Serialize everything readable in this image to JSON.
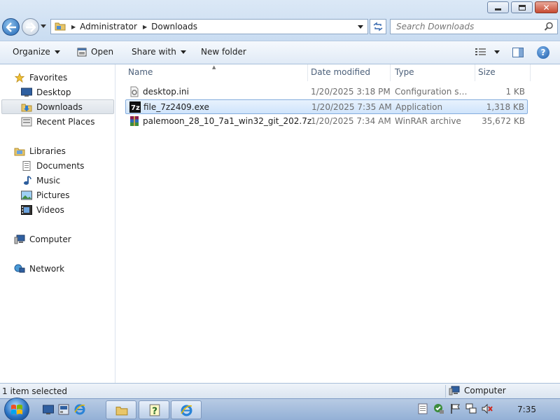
{
  "window": {
    "title_buttons": {
      "minimize": "minimize-icon",
      "maximize": "maximize-icon",
      "close": "close-icon"
    }
  },
  "address": {
    "crumbs": [
      "Administrator",
      "Downloads"
    ]
  },
  "search": {
    "placeholder": "Search Downloads"
  },
  "toolbar": {
    "organize": "Organize",
    "open": "Open",
    "share_with": "Share with",
    "new_folder": "New folder"
  },
  "nav": {
    "favorites": {
      "label": "Favorites",
      "items": [
        {
          "label": "Desktop",
          "icon": "desktop-icon"
        },
        {
          "label": "Downloads",
          "icon": "downloads-folder-icon",
          "selected": true
        },
        {
          "label": "Recent Places",
          "icon": "recent-places-icon"
        }
      ]
    },
    "libraries": {
      "label": "Libraries",
      "items": [
        {
          "label": "Documents",
          "icon": "documents-icon"
        },
        {
          "label": "Music",
          "icon": "music-icon"
        },
        {
          "label": "Pictures",
          "icon": "pictures-icon"
        },
        {
          "label": "Videos",
          "icon": "videos-icon"
        }
      ]
    },
    "computer": {
      "label": "Computer"
    },
    "network": {
      "label": "Network"
    }
  },
  "columns": {
    "name": "Name",
    "date": "Date modified",
    "type": "Type",
    "size": "Size"
  },
  "files": [
    {
      "name": "desktop.ini",
      "date": "1/20/2025 3:18 PM",
      "type": "Configuration sett...",
      "size": "1 KB",
      "icon": "config-file-icon",
      "selected": false
    },
    {
      "name": "file_7z2409.exe",
      "date": "1/20/2025 7:35 AM",
      "type": "Application",
      "size": "1,318 KB",
      "icon": "7zip-icon",
      "selected": true
    },
    {
      "name": "palemoon_28_10_7a1_win32_git_202.7z",
      "date": "1/20/2025 7:34 AM",
      "type": "WinRAR archive",
      "size": "35,672 KB",
      "icon": "winrar-icon",
      "selected": false
    }
  ],
  "status": {
    "selection": "1 item selected",
    "location": "Computer"
  },
  "taskbar": {
    "clock": "7:35"
  },
  "colors": {
    "accent": "#1d64b4",
    "selection": "#cfe4fb",
    "selection_border": "#84acdd"
  }
}
